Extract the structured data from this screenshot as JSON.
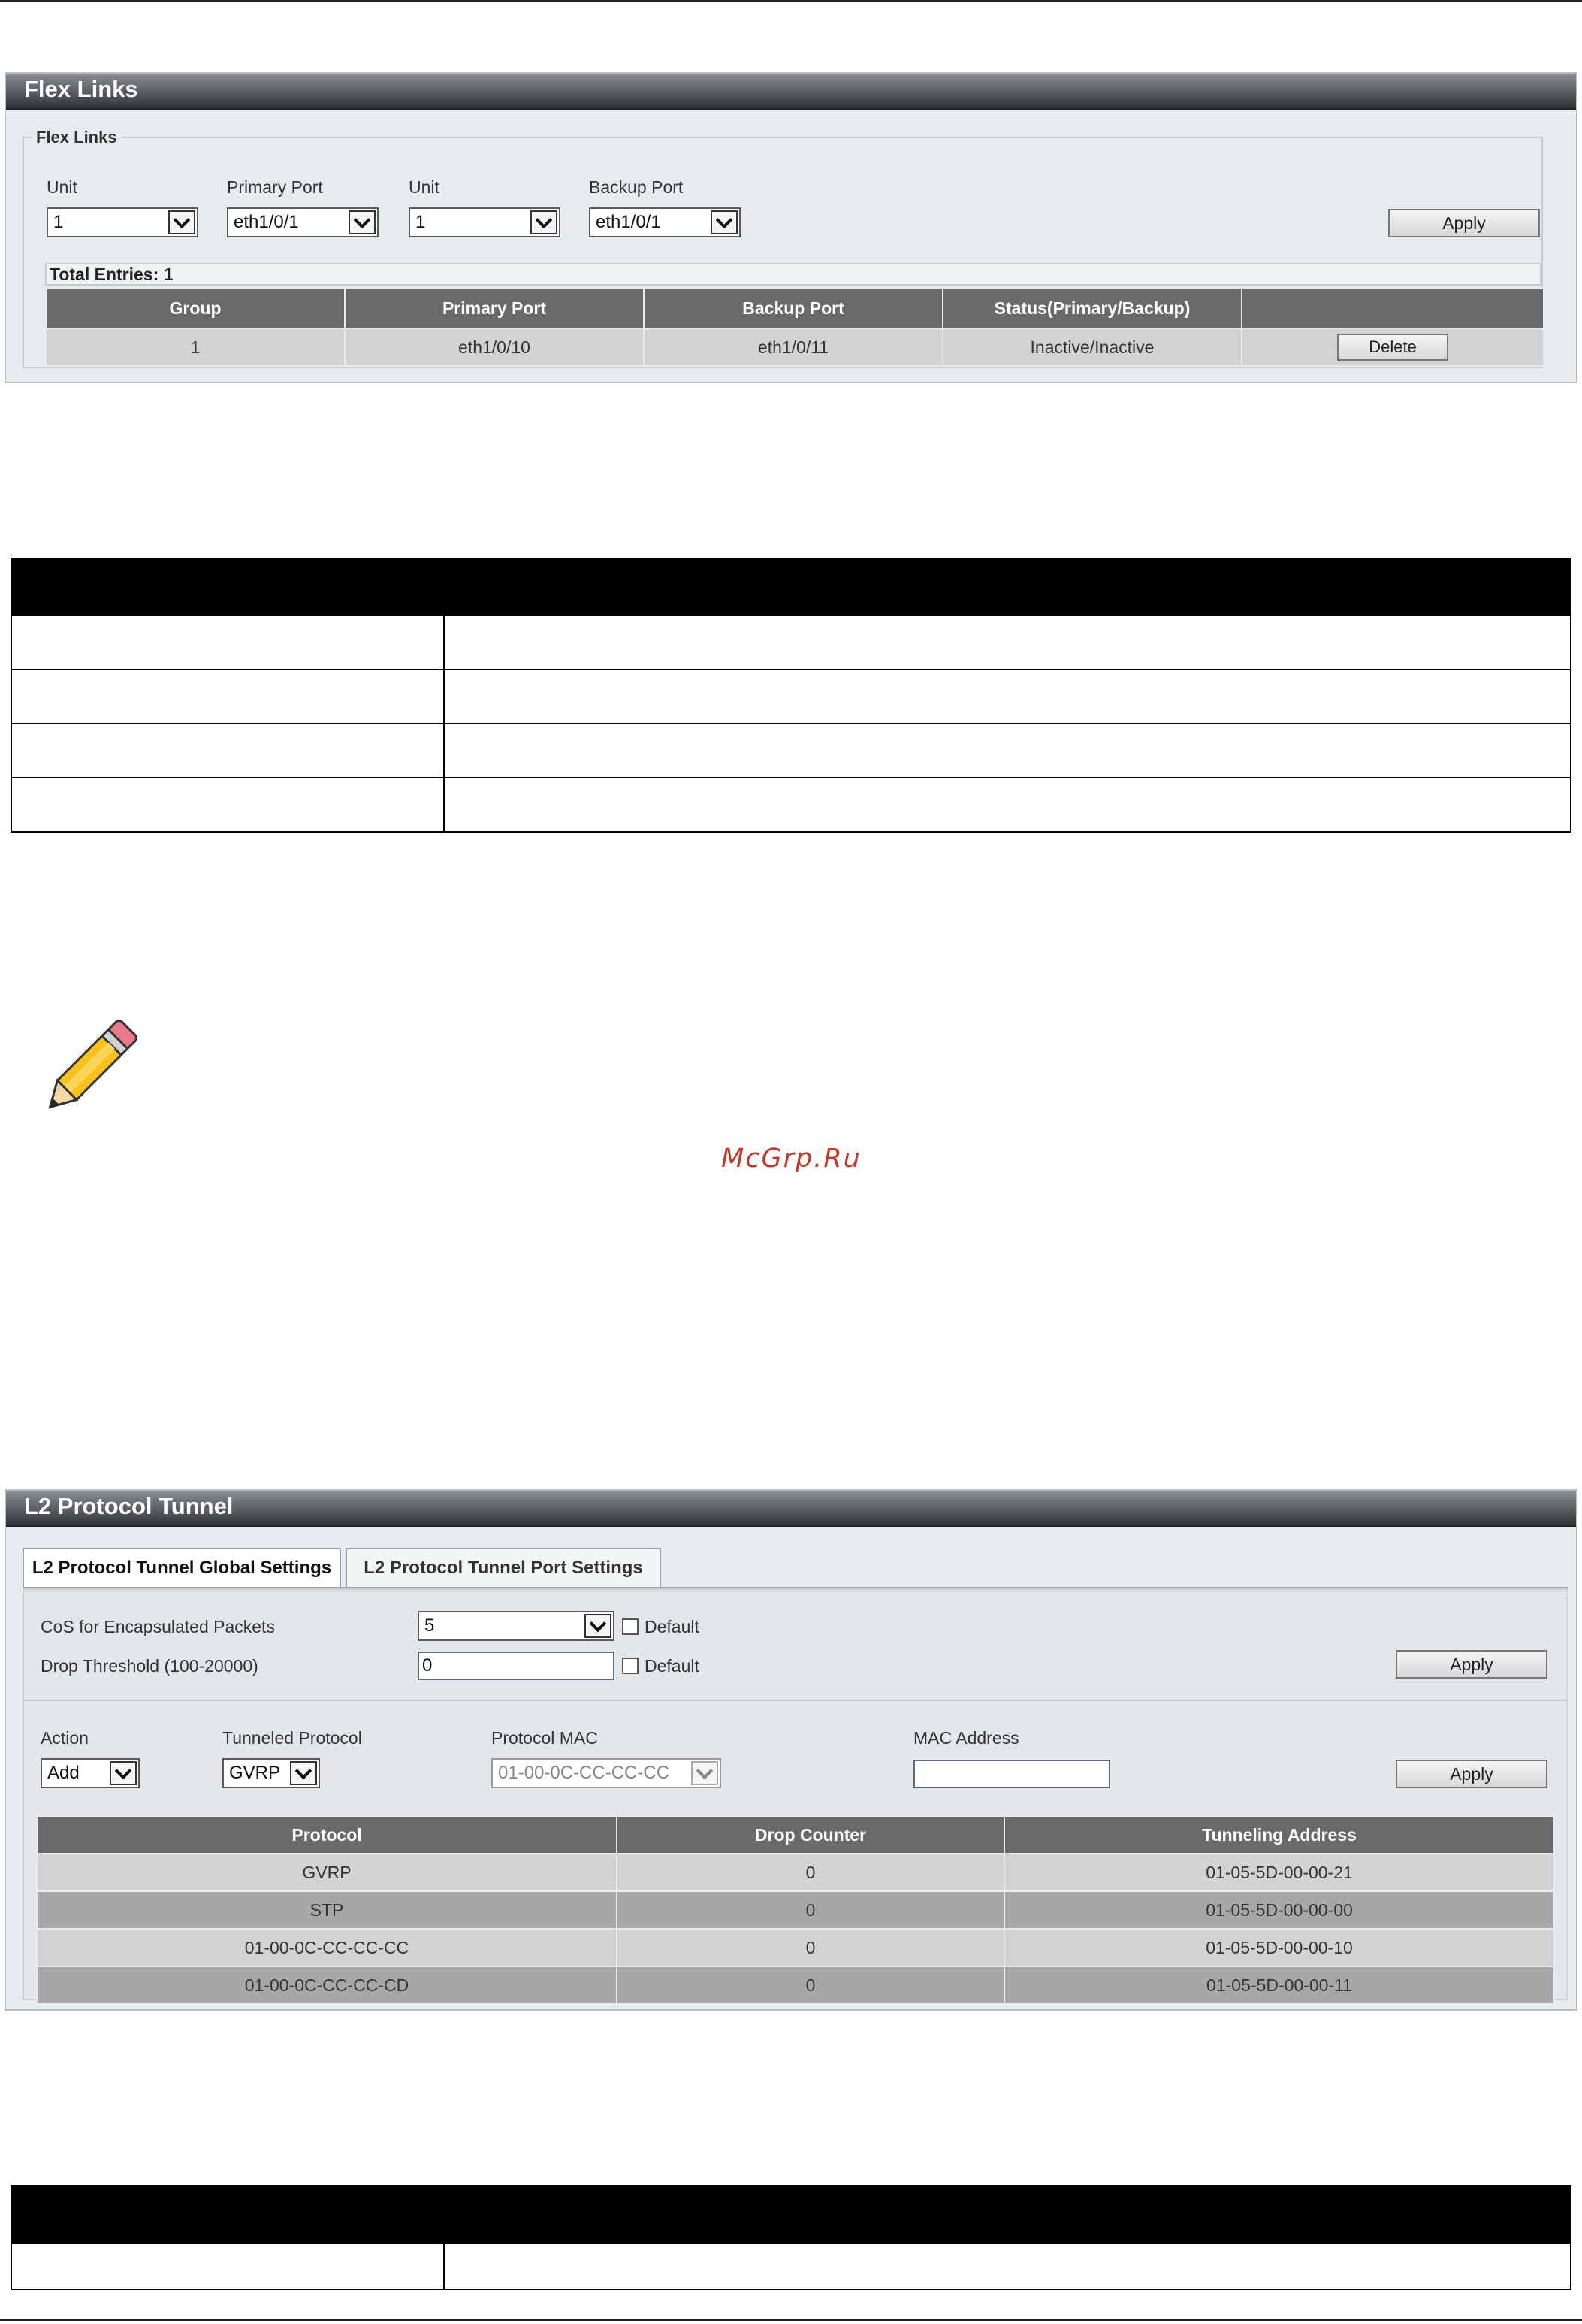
{
  "flex_links": {
    "title": "Flex Links",
    "group_legend": "Flex Links",
    "labels": {
      "unit1": "Unit",
      "primary_port": "Primary Port",
      "unit2": "Unit",
      "backup_port": "Backup Port"
    },
    "values": {
      "unit1": "1",
      "primary_port": "eth1/0/1",
      "unit2": "1",
      "backup_port": "eth1/0/1"
    },
    "apply_label": "Apply",
    "total_entries": "Total Entries: 1",
    "table": {
      "headers": [
        "Group",
        "Primary Port",
        "Backup Port",
        "Status(Primary/Backup)",
        ""
      ],
      "rows": [
        {
          "group": "1",
          "primary": "eth1/0/10",
          "backup": "eth1/0/11",
          "status": "Inactive/Inactive",
          "action": "Delete"
        }
      ]
    }
  },
  "watermark": "McGrp.Ru",
  "l2pt": {
    "title": "L2 Protocol Tunnel",
    "tabs": [
      "L2 Protocol Tunnel Global Settings",
      "L2 Protocol Tunnel Port Settings"
    ],
    "cos_label": "CoS for Encapsulated Packets",
    "cos_value": "5",
    "drop_label": "Drop Threshold (100-20000)",
    "drop_value": "0",
    "default_label": "Default",
    "apply_label": "Apply",
    "labels": {
      "action": "Action",
      "tunneled_protocol": "Tunneled Protocol",
      "protocol_mac": "Protocol MAC",
      "mac_address": "MAC Address"
    },
    "values": {
      "action": "Add",
      "tunneled_protocol": "GVRP",
      "protocol_mac": "01-00-0C-CC-CC-CC",
      "mac_address": ""
    },
    "table": {
      "headers": [
        "Protocol",
        "Drop Counter",
        "Tunneling Address"
      ],
      "rows": [
        {
          "protocol": "GVRP",
          "drop": "0",
          "address": "01-05-5D-00-00-21"
        },
        {
          "protocol": "STP",
          "drop": "0",
          "address": "01-05-5D-00-00-00"
        },
        {
          "protocol": "01-00-0C-CC-CC-CC",
          "drop": "0",
          "address": "01-05-5D-00-00-10"
        },
        {
          "protocol": "01-00-0C-CC-CC-CD",
          "drop": "0",
          "address": "01-05-5D-00-00-11"
        }
      ]
    }
  }
}
